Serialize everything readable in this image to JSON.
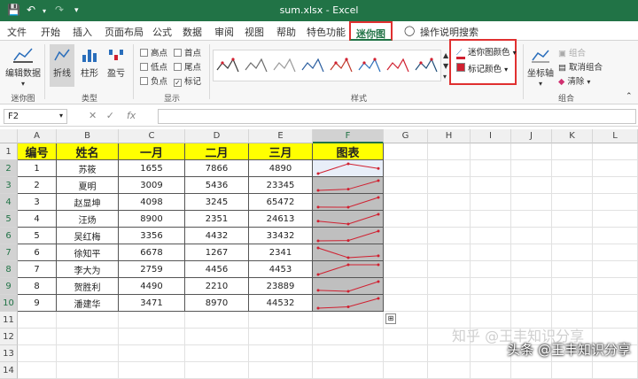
{
  "window": {
    "title": "sum.xlsx  -  Excel"
  },
  "tabs": [
    "文件",
    "开始",
    "插入",
    "页面布局",
    "公式",
    "数据",
    "审阅",
    "视图",
    "帮助",
    "特色功能",
    "迷你图"
  ],
  "active_tab": "迷你图",
  "tell_me": "操作说明搜索",
  "ribbon": {
    "sparkline_group": {
      "edit_data": "编辑数据",
      "label": "迷你图"
    },
    "type_group": {
      "line": "折线",
      "column": "柱形",
      "winloss": "盈亏",
      "label": "类型"
    },
    "show_group": {
      "high": "高点",
      "first": "首点",
      "low": "低点",
      "last": "尾点",
      "negative": "负点",
      "markers": "标记",
      "label": "显示"
    },
    "style_group": {
      "label": "样式",
      "sparkline_color": "迷你图颜色",
      "marker_color": "标记颜色"
    },
    "combine_group": {
      "axis": "坐标轴",
      "group": "组合",
      "ungroup": "取消组合",
      "clear": "清除",
      "label": "组合"
    }
  },
  "formula_bar": {
    "name_box": "F2",
    "fx": "fx",
    "cancel": "✕",
    "confirm": "✓"
  },
  "columns": [
    "A",
    "B",
    "C",
    "D",
    "E",
    "F",
    "G",
    "H",
    "I",
    "J",
    "K",
    "L"
  ],
  "rows": [
    "1",
    "2",
    "3",
    "4",
    "5",
    "6",
    "7",
    "8",
    "9",
    "10",
    "11",
    "12",
    "13",
    "14"
  ],
  "table": {
    "headers": [
      "编号",
      "姓名",
      "一月",
      "二月",
      "三月",
      "图表"
    ],
    "data": [
      [
        "1",
        "苏筱",
        "1655",
        "7866",
        "4890"
      ],
      [
        "2",
        "夏明",
        "3009",
        "5436",
        "23345"
      ],
      [
        "3",
        "赵显坤",
        "4098",
        "3245",
        "65472"
      ],
      [
        "4",
        "汪炀",
        "8900",
        "2351",
        "24613"
      ],
      [
        "5",
        "吴红梅",
        "3356",
        "4432",
        "33432"
      ],
      [
        "6",
        "徐知平",
        "6678",
        "1267",
        "2341"
      ],
      [
        "7",
        "李大为",
        "2759",
        "4456",
        "4453"
      ],
      [
        "8",
        "贺胜利",
        "4490",
        "2210",
        "23889"
      ],
      [
        "9",
        "潘建华",
        "3471",
        "8970",
        "44532"
      ]
    ]
  },
  "watermark": "头条 @王丰知识分享",
  "watermark_faint": "知乎 @王丰知识分享",
  "colors": {
    "excel_green": "#217346",
    "header_yellow": "#ffff00",
    "spark_red": "#d02030",
    "highlight": "#e03030"
  }
}
